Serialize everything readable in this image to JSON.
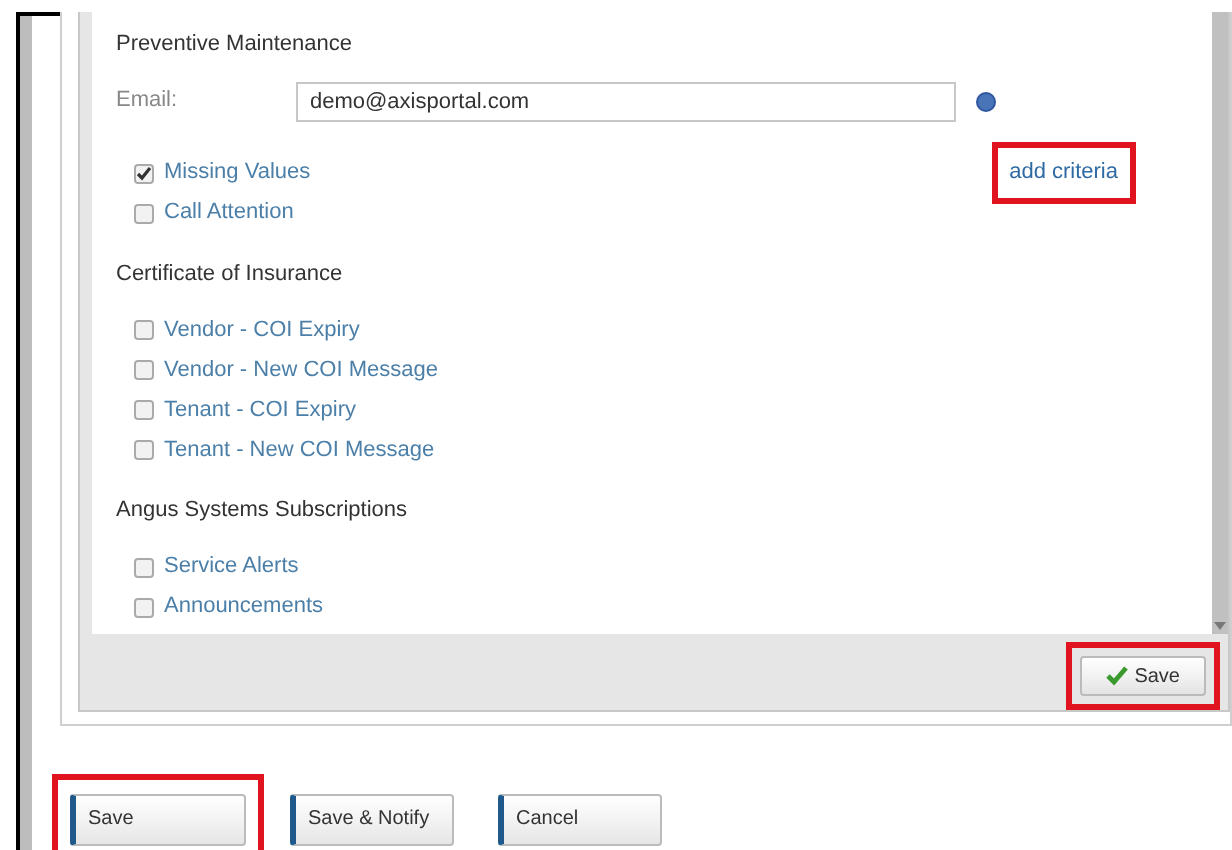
{
  "sections": [
    {
      "title": "Preventive Maintenance",
      "email": {
        "label": "Email:",
        "value": "demo@axisportal.com"
      },
      "link": {
        "label": "add criteria",
        "highlighted": true
      },
      "options": [
        {
          "label": "Missing Values",
          "checked": true
        },
        {
          "label": "Call Attention",
          "checked": false
        }
      ]
    },
    {
      "title": "Certificate of Insurance",
      "options": [
        {
          "label": "Vendor - COI Expiry",
          "checked": false
        },
        {
          "label": "Vendor - New COI Message",
          "checked": false
        },
        {
          "label": "Tenant - COI Expiry",
          "checked": false
        },
        {
          "label": "Tenant - New COI Message",
          "checked": false
        }
      ]
    },
    {
      "title": "Angus Systems Subscriptions",
      "options": [
        {
          "label": "Service Alerts",
          "checked": false
        },
        {
          "label": "Announcements",
          "checked": false
        }
      ]
    }
  ],
  "panel_save": {
    "label": "Save",
    "highlighted": true
  },
  "buttons": [
    {
      "label": "Save",
      "highlighted": true
    },
    {
      "label": "Save & Notify",
      "highlighted": false
    },
    {
      "label": "Cancel",
      "highlighted": false
    }
  ]
}
